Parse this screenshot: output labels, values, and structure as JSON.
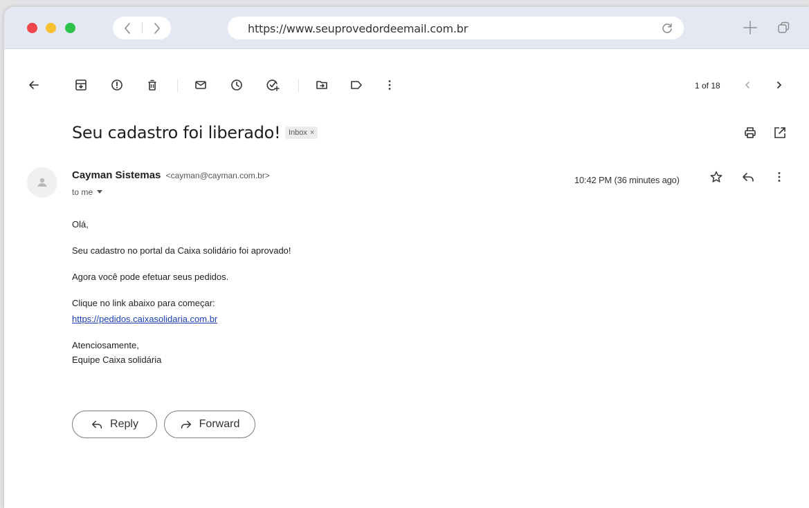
{
  "browser": {
    "url": "https://www.seuprovedordeemail.com.br",
    "traffic_lights": {
      "close": "#f0454a",
      "minimize": "#f6c132",
      "maximize": "#2fc24b"
    }
  },
  "toolbar": {
    "icons": [
      "back-arrow-icon",
      "archive-icon",
      "report-spam-icon",
      "delete-icon",
      "mark-unread-icon",
      "snooze-icon",
      "add-to-tasks-icon",
      "move-to-icon",
      "label-icon",
      "more-vert-icon"
    ],
    "counter": "1 of 18"
  },
  "email": {
    "subject": "Seu cadastro foi liberado!",
    "label": "Inbox",
    "label_close": "×",
    "sender_name": "Cayman Sistemas",
    "sender_email": "<cayman@cayman.com.br>",
    "recipient": "to me",
    "timestamp": "10:42 PM (36 minutes ago)",
    "body": {
      "greeting": "Olá,",
      "line1": "Seu cadastro no portal da Caixa solidário foi aprovado!",
      "line2": "Agora você pode efetuar seus pedidos.",
      "line3": "Clique no link abaixo para começar:",
      "link": "https://pedidos.caixasolidaria.com.br",
      "signoff": "Atenciosamente,",
      "signature": "Equipe Caixa solidária"
    },
    "actions": {
      "reply": "Reply",
      "forward": "Forward"
    }
  }
}
